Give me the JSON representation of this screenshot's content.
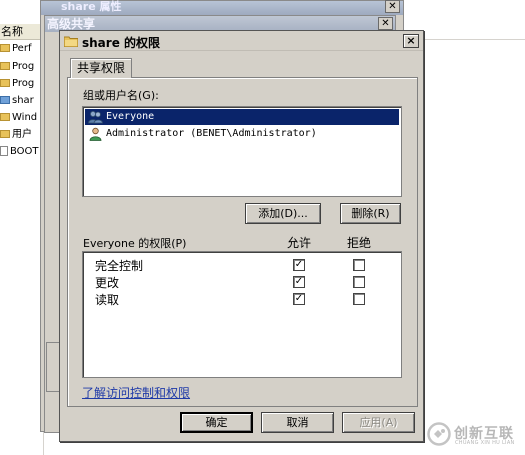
{
  "background": {
    "window1_title": "share 属性",
    "window2_title": "高级共享",
    "explorer_column_header": "名称",
    "explorer_items": [
      {
        "label": "Perf",
        "icon": "folder-icon"
      },
      {
        "label": "Prog",
        "icon": "folder-icon"
      },
      {
        "label": "Prog",
        "icon": "folder-icon"
      },
      {
        "label": "shar",
        "icon": "shared-folder-icon"
      },
      {
        "label": "Wind",
        "icon": "folder-icon"
      },
      {
        "label": "用户",
        "icon": "folder-icon"
      },
      {
        "label": "BOOT",
        "icon": "file-icon"
      }
    ]
  },
  "dialog": {
    "title": "share 的权限",
    "close_label": "×",
    "tab_label": "共享权限",
    "group_label": "组或用户名(G):",
    "users": [
      {
        "name": "Everyone",
        "selected": true,
        "icon": "group-users-icon"
      },
      {
        "name": "Administrator (BENET\\Administrator)",
        "selected": false,
        "icon": "admin-user-icon"
      }
    ],
    "add_button": "添加(D)...",
    "remove_button": "删除(R)",
    "permissions_label": "Everyone 的权限(P)",
    "allow_header": "允许",
    "deny_header": "拒绝",
    "permissions": [
      {
        "name": "完全控制",
        "allow": true,
        "deny": false
      },
      {
        "name": "更改",
        "allow": true,
        "deny": false
      },
      {
        "name": "读取",
        "allow": true,
        "deny": false
      }
    ],
    "help_link": "了解访问控制和权限",
    "ok_button": "确定",
    "cancel_button": "取消",
    "apply_button": "应用(A)",
    "check_glyph": "✓"
  },
  "watermark": {
    "brand": "创新互联",
    "sub": "CHUANG XIN HU LIAN"
  },
  "colors": {
    "selection": "#0a246a",
    "link": "#1f3aa8",
    "dialog_face": "#d4d0c8"
  }
}
